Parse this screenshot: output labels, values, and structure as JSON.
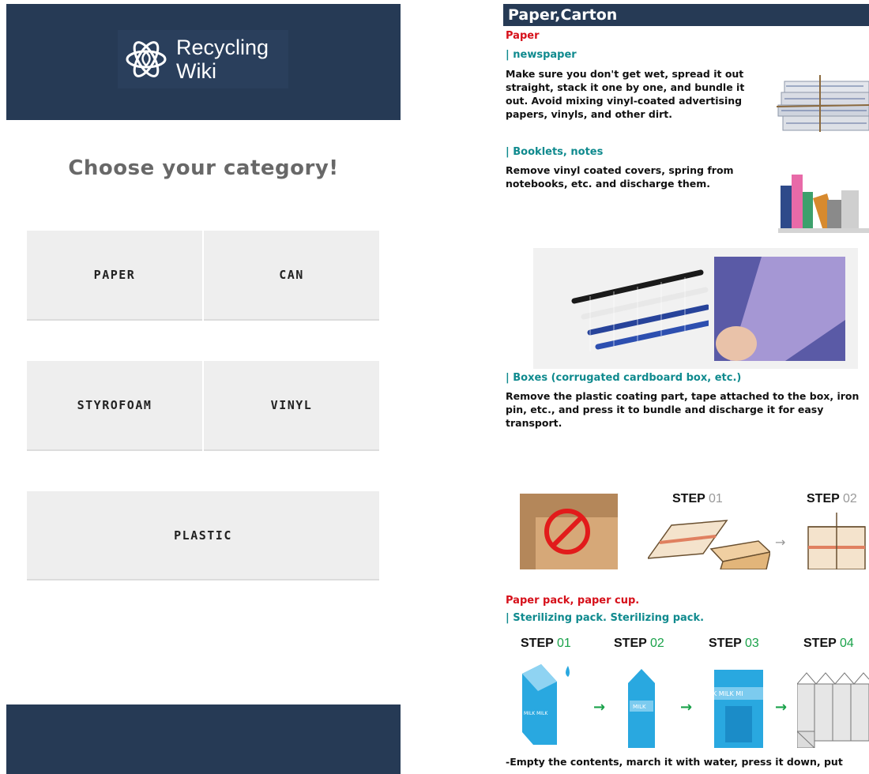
{
  "app": {
    "logo_line1": "Recycling",
    "logo_line2": "Wiki"
  },
  "main": {
    "title": "Choose your category!",
    "categories": [
      "PAPER",
      "CAN",
      "STYROFOAM",
      "VINYL",
      "PLASTIC"
    ]
  },
  "detail": {
    "header": "Paper,Carton",
    "paper_heading": "Paper",
    "newspaper_heading": "| newspaper",
    "newspaper_text": "Make sure you don't get wet, spread it out straight, stack it one by one, and bundle it out.  Avoid mixing vinyl-coated advertising papers, vinyls, and other dirt.",
    "booklets_heading": "| Booklets, notes",
    "booklets_text": "Remove vinyl coated covers, spring from notebooks, etc. and discharge them.",
    "boxes_heading": "| Boxes (corrugated cardboard box, etc.)",
    "boxes_text": "Remove the plastic coating part, tape attached to the box, iron pin, etc., and press it to bundle and discharge it for easy transport.",
    "box_steps": [
      {
        "word": "STEP",
        "num": "01"
      },
      {
        "word": "STEP",
        "num": "02"
      }
    ],
    "pack_heading": "Paper pack, paper cup.",
    "pack_sub": "| Sterilizing pack. Sterilizing pack.",
    "pack_steps": [
      {
        "word": "STEP",
        "num": "01"
      },
      {
        "word": "STEP",
        "num": "02"
      },
      {
        "word": "STEP",
        "num": "03"
      },
      {
        "word": "STEP",
        "num": "04"
      }
    ],
    "milk_label": "MILK",
    "milk_label_2": "MILK MILK",
    "milk_label_3": "K MILK MI",
    "footer_text": "-Empty the contents, march it with water, press it down, put"
  },
  "colors": {
    "navy": "#263a55",
    "red": "#d6101a",
    "teal": "#0f8a8e",
    "step_green": "#1aa24a",
    "milk_blue": "#29a8e0"
  }
}
